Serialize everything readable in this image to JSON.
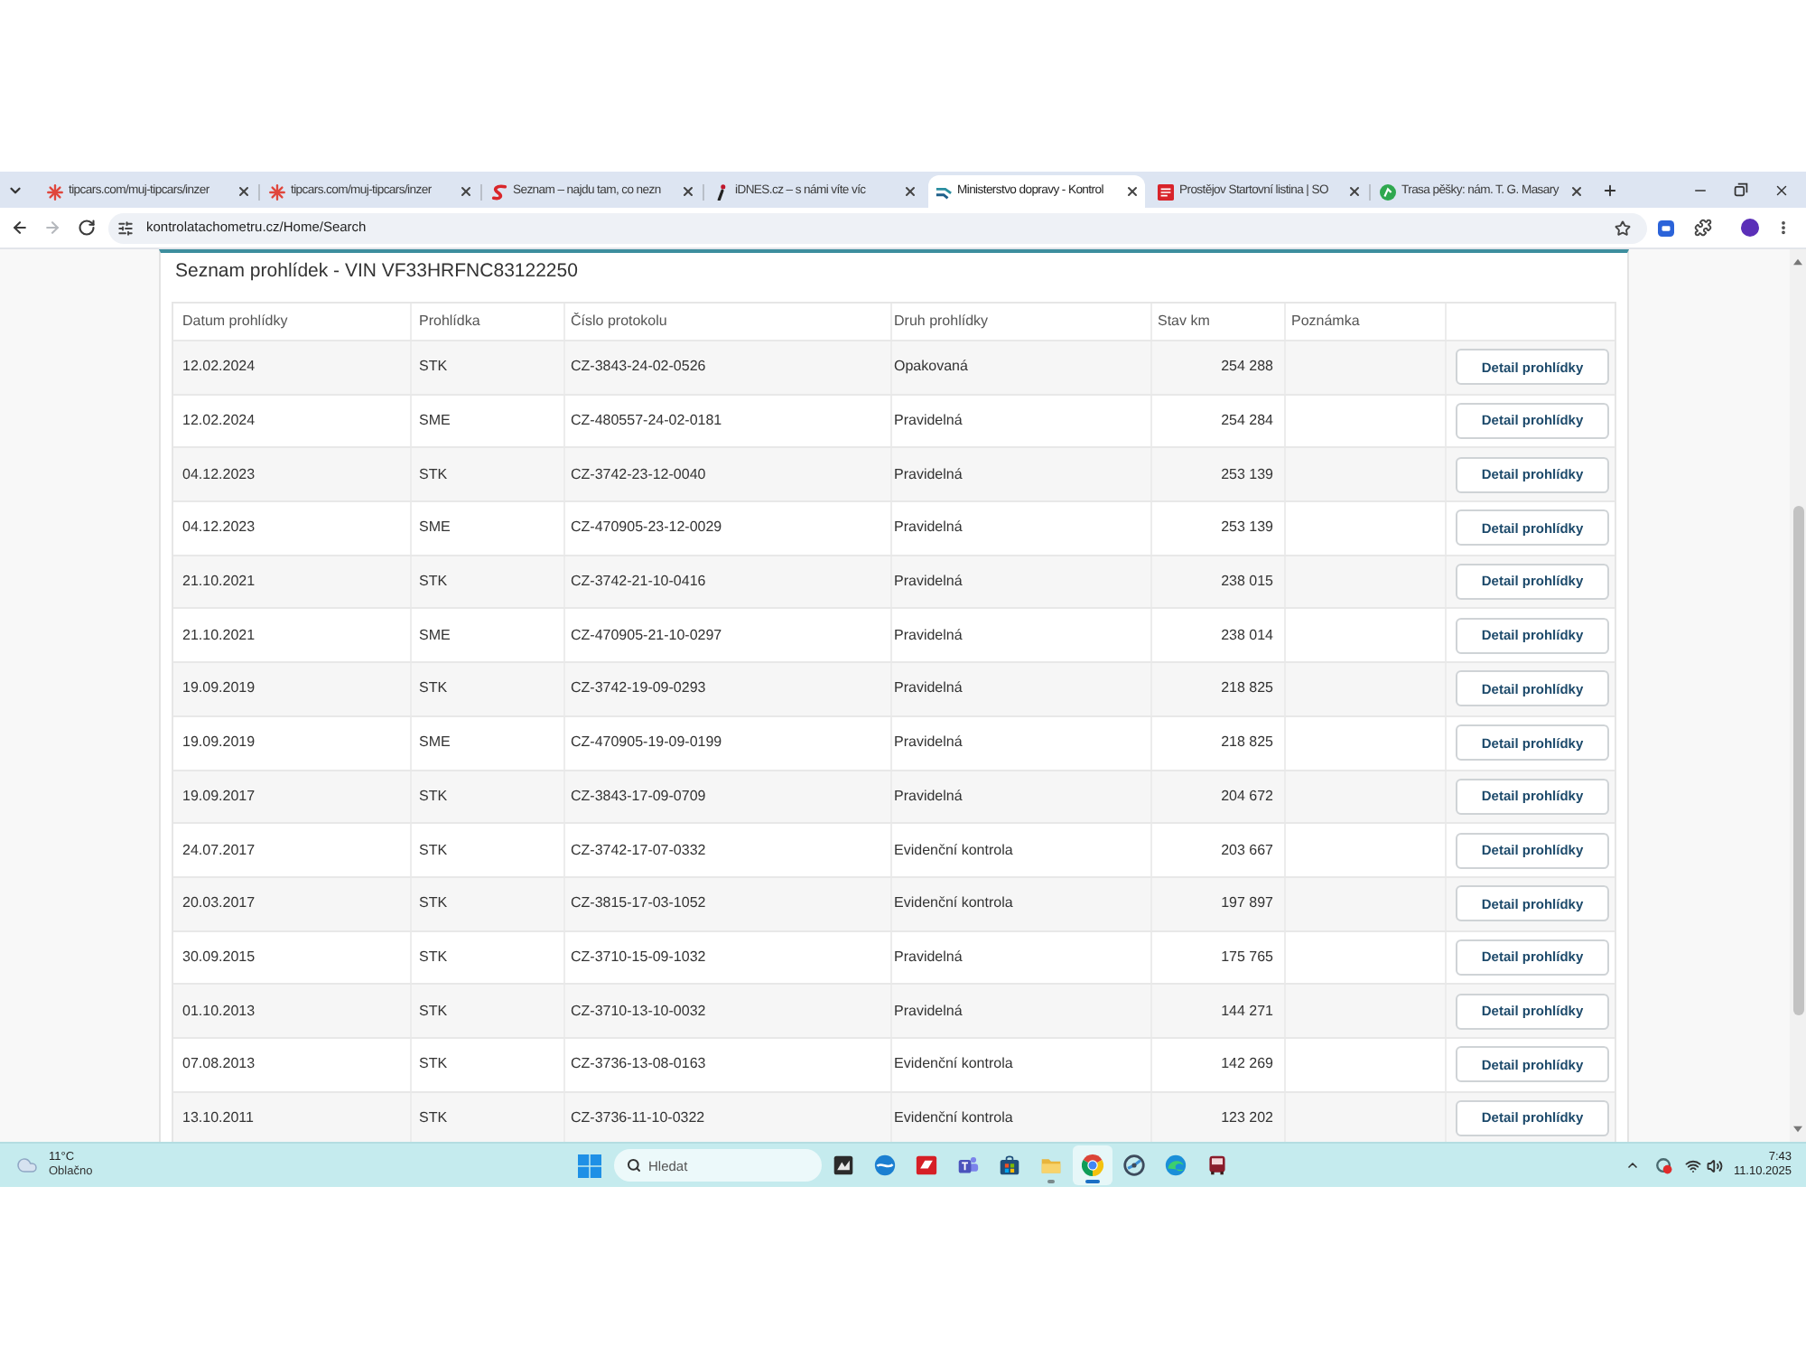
{
  "browser": {
    "tabs": [
      {
        "title": "tipcars.com/muj-tipcars/inzer",
        "selected": false
      },
      {
        "title": "tipcars.com/muj-tipcars/inzer",
        "selected": false
      },
      {
        "title": "Seznam – najdu tam, co nezn",
        "selected": false
      },
      {
        "title": "iDNES.cz – s námi víte víc",
        "selected": false
      },
      {
        "title": "Ministerstvo dopravy - Kontrol",
        "selected": true
      },
      {
        "title": "Prostějov Startovní listina | SO",
        "selected": false
      },
      {
        "title": "Trasa pěšky: nám. T. G. Masary",
        "selected": false
      }
    ],
    "navigation": {
      "back_disabled": false,
      "forward_disabled": true
    },
    "url": "kontrolatachometru.cz/Home/Search"
  },
  "page": {
    "title": "Seznam prohlídek - VIN VF33HRFNC83122250",
    "table": {
      "columns": [
        "Datum prohlídky",
        "Prohlídka",
        "Číslo protokolu",
        "Druh prohlídky",
        "Stav km",
        "Poznámka"
      ],
      "rows": [
        {
          "date": "12.02.2024",
          "inspection": "STK",
          "protocol_number": "CZ-3843-24-02-0526",
          "inspection_type": "Opakovaná",
          "odometer_km": "254 288",
          "action": "Detail prohlídky"
        },
        {
          "date": "12.02.2024",
          "inspection": "SME",
          "protocol_number": "CZ-480557-24-02-0181",
          "inspection_type": "Pravidelná",
          "odometer_km": "254 284",
          "action": "Detail prohlídky"
        },
        {
          "date": "04.12.2023",
          "inspection": "STK",
          "protocol_number": "CZ-3742-23-12-0040",
          "inspection_type": "Pravidelná",
          "odometer_km": "253 139",
          "action": "Detail prohlídky"
        },
        {
          "date": "04.12.2023",
          "inspection": "SME",
          "protocol_number": "CZ-470905-23-12-0029",
          "inspection_type": "Pravidelná",
          "odometer_km": "253 139",
          "action": "Detail prohlídky"
        },
        {
          "date": "21.10.2021",
          "inspection": "STK",
          "protocol_number": "CZ-3742-21-10-0416",
          "inspection_type": "Pravidelná",
          "odometer_km": "238 015",
          "action": "Detail prohlídky"
        },
        {
          "date": "21.10.2021",
          "inspection": "SME",
          "protocol_number": "CZ-470905-21-10-0297",
          "inspection_type": "Pravidelná",
          "odometer_km": "238 014",
          "action": "Detail prohlídky"
        },
        {
          "date": "19.09.2019",
          "inspection": "STK",
          "protocol_number": "CZ-3742-19-09-0293",
          "inspection_type": "Pravidelná",
          "odometer_km": "218 825",
          "action": "Detail prohlídky"
        },
        {
          "date": "19.09.2019",
          "inspection": "SME",
          "protocol_number": "CZ-470905-19-09-0199",
          "inspection_type": "Pravidelná",
          "odometer_km": "218 825",
          "action": "Detail prohlídky"
        },
        {
          "date": "19.09.2017",
          "inspection": "STK",
          "protocol_number": "CZ-3843-17-09-0709",
          "inspection_type": "Pravidelná",
          "odometer_km": "204 672",
          "action": "Detail prohlídky"
        },
        {
          "date": "24.07.2017",
          "inspection": "STK",
          "protocol_number": "CZ-3742-17-07-0332",
          "inspection_type": "Evidenční kontrola",
          "odometer_km": "203 667",
          "action": "Detail prohlídky"
        },
        {
          "date": "20.03.2017",
          "inspection": "STK",
          "protocol_number": "CZ-3815-17-03-1052",
          "inspection_type": "Evidenční kontrola",
          "odometer_km": "197 897",
          "action": "Detail prohlídky"
        },
        {
          "date": "30.09.2015",
          "inspection": "STK",
          "protocol_number": "CZ-3710-15-09-1032",
          "inspection_type": "Pravidelná",
          "odometer_km": "175 765",
          "action": "Detail prohlídky"
        },
        {
          "date": "01.10.2013",
          "inspection": "STK",
          "protocol_number": "CZ-3710-13-10-0032",
          "inspection_type": "Pravidelná",
          "odometer_km": "144 271",
          "action": "Detail prohlídky"
        },
        {
          "date": "07.08.2013",
          "inspection": "STK",
          "protocol_number": "CZ-3736-13-08-0163",
          "inspection_type": "Evidenční kontrola",
          "odometer_km": "142 269",
          "action": "Detail prohlídky"
        },
        {
          "date": "13.10.2011",
          "inspection": "STK",
          "protocol_number": "CZ-3736-11-10-0322",
          "inspection_type": "Evidenční kontrola",
          "odometer_km": "123 202",
          "action": "Detail prohlídky"
        }
      ]
    }
  },
  "taskbar": {
    "weather": {
      "temperature": "11°C",
      "condition": "Oblačno"
    },
    "search": {
      "placeholder": "Hledat"
    },
    "apps": [
      {
        "running": false,
        "active": false
      },
      {
        "running": false,
        "active": false
      },
      {
        "running": false,
        "active": false
      },
      {
        "running": false,
        "active": false
      },
      {
        "running": false,
        "active": false
      },
      {
        "running": true,
        "active": false
      },
      {
        "running": true,
        "active": true
      },
      {
        "running": false,
        "active": false
      },
      {
        "running": false,
        "active": false
      },
      {
        "running": false,
        "active": false
      }
    ],
    "clock": {
      "time": "7:43",
      "date": "11.10.2025"
    }
  }
}
